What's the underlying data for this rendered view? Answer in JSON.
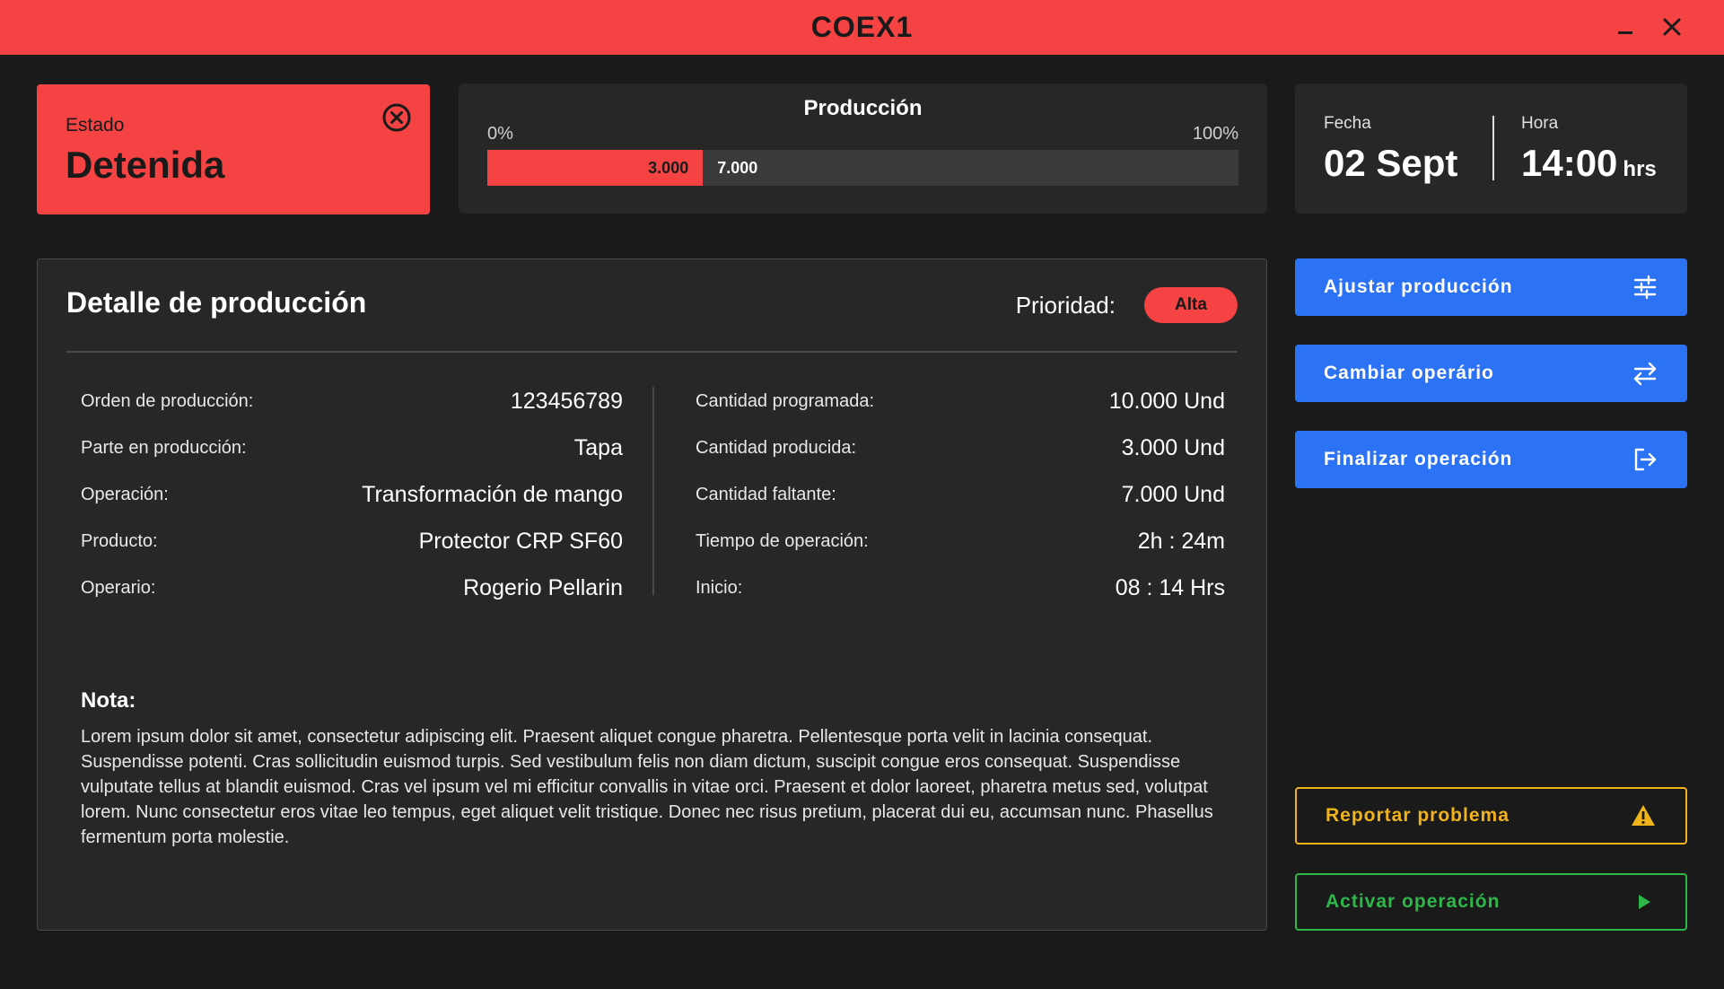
{
  "window": {
    "title": "COEX1"
  },
  "estado": {
    "label": "Estado",
    "value": "Detenida",
    "icon": "close-circle-icon",
    "color": "#f54343"
  },
  "produccion": {
    "title": "Producción",
    "min_label": "0%",
    "max_label": "100%",
    "produced_label": "3.000",
    "remaining_label": "7.000",
    "progress_fraction": 0.287
  },
  "fecha": {
    "label": "Fecha",
    "value": "02 Sept"
  },
  "hora": {
    "label": "Hora",
    "value": "14:00",
    "unit": "hrs"
  },
  "detalle": {
    "title": "Detalle de producción",
    "priority_label": "Prioridad:",
    "priority_value": "Alta",
    "left": [
      {
        "key": "Orden de producción:",
        "value": "123456789"
      },
      {
        "key": "Parte en producción:",
        "value": "Tapa"
      },
      {
        "key": "Operación:",
        "value": "Transformación de mango"
      },
      {
        "key": "Producto:",
        "value": "Protector CRP SF60"
      },
      {
        "key": "Operario:",
        "value": "Rogerio Pellarin"
      }
    ],
    "right": [
      {
        "key": "Cantidad programada:",
        "value": "10.000 Und"
      },
      {
        "key": "Cantidad producida:",
        "value": "3.000 Und"
      },
      {
        "key": "Cantidad faltante:",
        "value": "7.000 Und"
      },
      {
        "key": "Tiempo de operación:",
        "value": "2h : 24m"
      },
      {
        "key": "Inicio:",
        "value": "08 : 14 Hrs"
      }
    ],
    "nota_label": "Nota:",
    "nota_text": "Lorem ipsum dolor sit amet, consectetur adipiscing elit. Praesent aliquet congue pharetra. Pellentesque porta velit in lacinia consequat. Suspendisse potenti. Cras sollicitudin euismod turpis. Sed vestibulum felis non diam dictum, suscipit congue eros consequat. Suspendisse vulputate tellus at blandit euismod. Cras vel ipsum vel mi efficitur convallis in vitae orci. Praesent et dolor laoreet, pharetra metus sed, volutpat lorem. Nunc consectetur eros vitae leo tempus, eget aliquet velit tristique. Donec nec risus pretium, placerat dui eu, accumsan nunc. Phasellus fermentum porta molestie."
  },
  "actions": {
    "ajustar": {
      "label": "Ajustar producción",
      "icon": "sliders-icon"
    },
    "cambiar": {
      "label": "Cambiar operário",
      "icon": "swap-arrows-icon"
    },
    "finalizar": {
      "label": "Finalizar operación",
      "icon": "exit-icon"
    },
    "reportar": {
      "label": "Reportar problema",
      "icon": "warning-triangle-icon"
    },
    "activar": {
      "label": "Activar operación",
      "icon": "play-icon"
    }
  },
  "colors": {
    "accent_red": "#f54343",
    "accent_blue": "#2b72f4",
    "warning": "#f1b31c",
    "success": "#2fb84a",
    "background": "#1a1a1a",
    "card": "#272727"
  }
}
